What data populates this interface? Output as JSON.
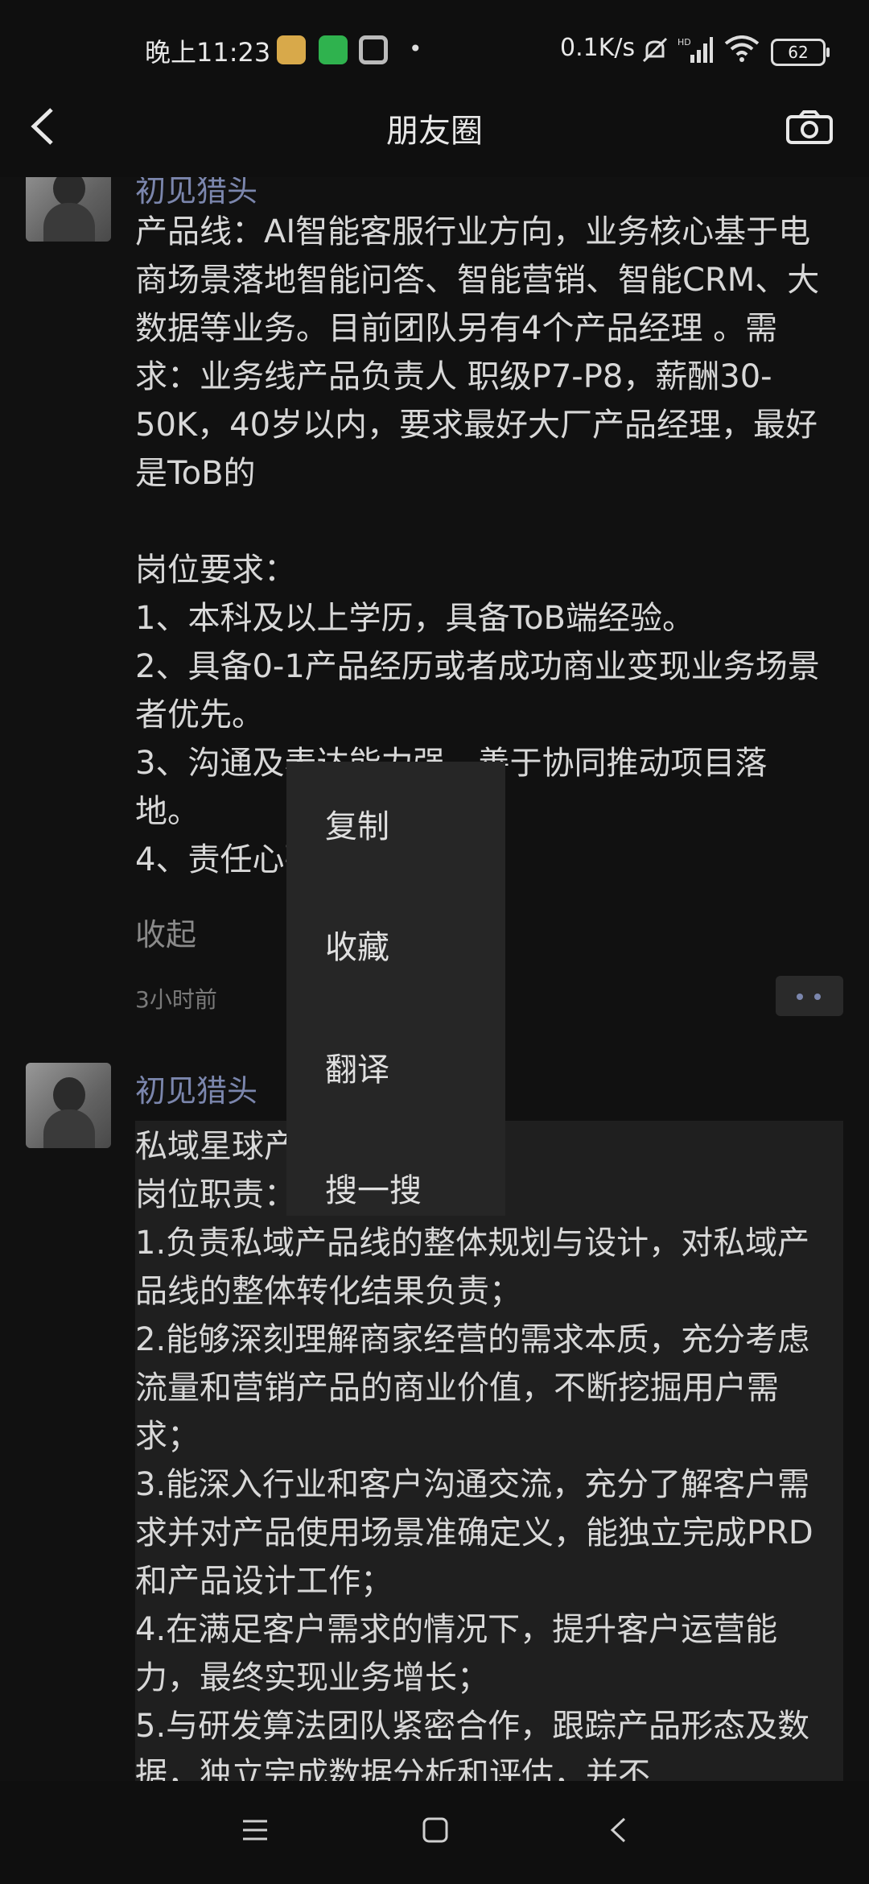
{
  "status_bar": {
    "time": "晚上11:23",
    "network_speed": "0.1K/s",
    "battery": "62",
    "icons": [
      "notification-app-icon",
      "shield-app-icon",
      "ring-app-icon",
      "mute-icon",
      "hd-signal-icon",
      "wifi-icon",
      "battery-icon"
    ]
  },
  "nav": {
    "title": "朋友圈",
    "back_icon": "back-chevron-icon",
    "camera_icon": "camera-icon"
  },
  "posts": [
    {
      "author": "初见猎头",
      "text": "产品线：AI智能客服行业方向，业务核心基于电商场景落地智能问答、智能营销、智能CRM、大数据等业务。目前团队另有4个产品经理 。需求：业务线产品负责人 职级P7-P8，薪酬30-50K，40岁以内，要求最好大厂产品经理，最好是ToB的\n\n岗位要求：\n1、本科及以上学历，具备ToB端经验。\n2、具备0-1产品经历或者成功商业变现业务场景者优先。\n3、沟通及表达能力强，善于协同推动项目落地。\n4、责任心强",
      "collapse": "收起",
      "time": "3小时前"
    },
    {
      "author": "初见猎头",
      "text": "私域星球产品经理JD：\n岗位职责：\n1.负责私域产品线的整体规划与设计，对私域产品线的整体转化结果负责；\n2.能够深刻理解商家经营的需求本质，充分考虑流量和营销产品的商业价值，不断挖掘用户需求；\n3.能深入行业和客户沟通交流，充分了解客户需求并对产品使用场景准确定义，能独立完成PRD和产品设计工作；\n4.在满足客户需求的情况下，提升客户运营能力，最终实现业务增长；\n5.与研发算法团队紧密合作，跟踪产品形态及数据，独立完成数据分析和评估，并不"
    }
  ],
  "context_menu": {
    "items": [
      "复制",
      "收藏",
      "翻译",
      "搜一搜"
    ]
  },
  "system_nav": {
    "icons": [
      "menu-icon",
      "home-icon",
      "back-icon"
    ]
  }
}
